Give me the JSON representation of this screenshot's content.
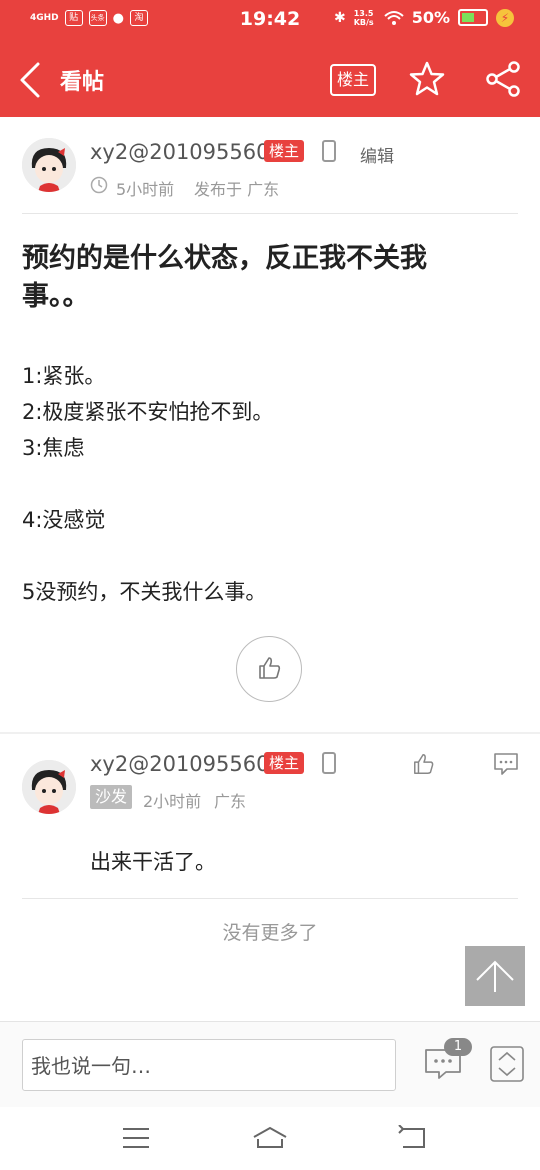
{
  "status_bar": {
    "network": "4GHD",
    "icons": [
      "贴",
      "头条",
      "淘"
    ],
    "time": "19:42",
    "speed": "13.5 KB/s",
    "battery": "50%"
  },
  "header": {
    "title": "看帖",
    "owner_button": "楼主"
  },
  "post": {
    "author": "xy2@201095560",
    "owner_tag": "楼主",
    "edit": "编辑",
    "time": "5小时前",
    "location": "发布于 广东",
    "title": "预约的是什么状态，反正我不关我事。。",
    "body": "1:紧张。\n2:极度紧张不安怕抢不到。\n3:焦虑\n\n4:没感觉\n\n5没预约，不关我什么事。"
  },
  "reply": {
    "author": "xy2@201095560",
    "owner_tag": "楼主",
    "floor_tag": "沙发",
    "time": "2小时前",
    "location": "广东",
    "content": "出来干活了。"
  },
  "footer": {
    "no_more": "没有更多了",
    "input_placeholder": "我也说一句…",
    "comment_count": "1"
  },
  "colors": {
    "brand": "#e8413e",
    "text": "#222222",
    "meta": "#999999"
  }
}
